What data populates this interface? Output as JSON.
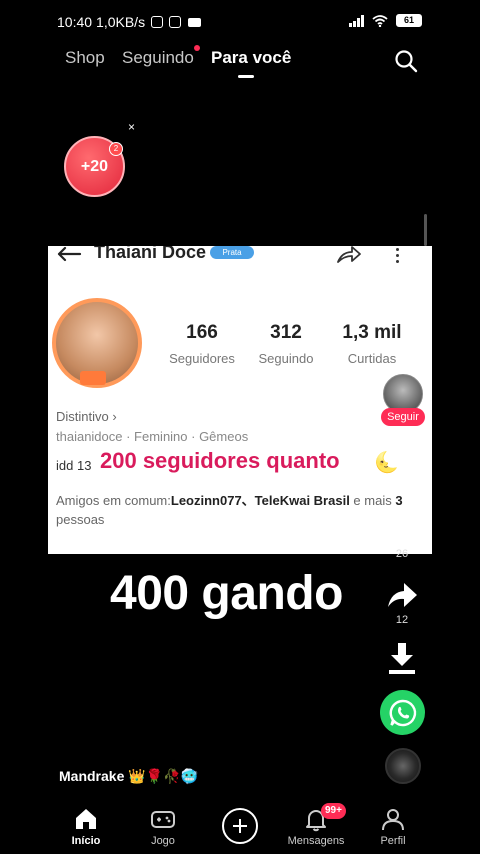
{
  "status_bar": {
    "time": "10:40",
    "speed": "1,0KB/s",
    "battery": "61"
  },
  "top_nav": {
    "tabs": [
      "Shop",
      "Seguindo",
      "Para você"
    ]
  },
  "reward": {
    "label": "+20",
    "badge": "2",
    "close": "×"
  },
  "embedded_profile": {
    "name": "Thaiani Doce",
    "level_badge": "Prata",
    "stats": [
      {
        "value": "166",
        "label": "Seguidores"
      },
      {
        "value": "312",
        "label": "Seguindo"
      },
      {
        "value": "1,3 mil",
        "label": "Curtidas"
      }
    ],
    "distintivo": "Distintivo ›",
    "info_line": "thaianidoce · Feminino · Gêmeos",
    "idd": "idd 13",
    "headline": "200 seguidores quanto",
    "headline_emoji": "🌜",
    "friends_prefix": "Amigos em comum:",
    "friends_names": "Leozinn077、TeleKwai Brasil",
    "friends_suffix": " e mais ",
    "friends_count": "3",
    "friends_end": " pessoas"
  },
  "follow_label": "Seguir",
  "caption": "400 gando",
  "side_actions": {
    "comments_count": "26",
    "share_count": "12"
  },
  "username": "Mandrake 👑🌹🥀🥶",
  "bottom_nav": {
    "home": "Início",
    "game": "Jogo",
    "messages": "Mensagens",
    "messages_badge": "99+",
    "profile": "Perfil"
  },
  "colors": {
    "accent": "#fe2c55",
    "headline": "#d91b5c",
    "whatsapp": "#25d366"
  }
}
